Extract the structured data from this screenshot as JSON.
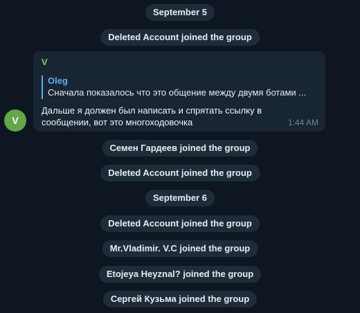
{
  "events": {
    "date1": "September 5",
    "join1": "Deleted Account joined the group",
    "join2": "Семен Гардеев joined the group",
    "join3": "Deleted Account joined the group",
    "date2": "September 6",
    "join4": "Deleted Account joined the group",
    "join5": "Mr.Vladimir. V.C joined the group",
    "join6": "Etojeya Heyznal? joined the group",
    "join7": "Сергей Кузьма joined the group"
  },
  "message": {
    "avatar_letter": "V",
    "sender": "V",
    "reply_author": "Oleg",
    "reply_text": "Сначала показалось что это общение между двумя ботами ...",
    "text": "Дальше я должен был написать и спрятать ссылку в сообщении, вот это многоходовочка",
    "time": "1:44 AM"
  },
  "colors": {
    "background": "#0e1621",
    "bubble": "#182533",
    "service_pill": "#1e2c3a",
    "sender_name": "#85c86a",
    "reply_accent": "#5bb0f2",
    "avatar": "#64a64b"
  }
}
